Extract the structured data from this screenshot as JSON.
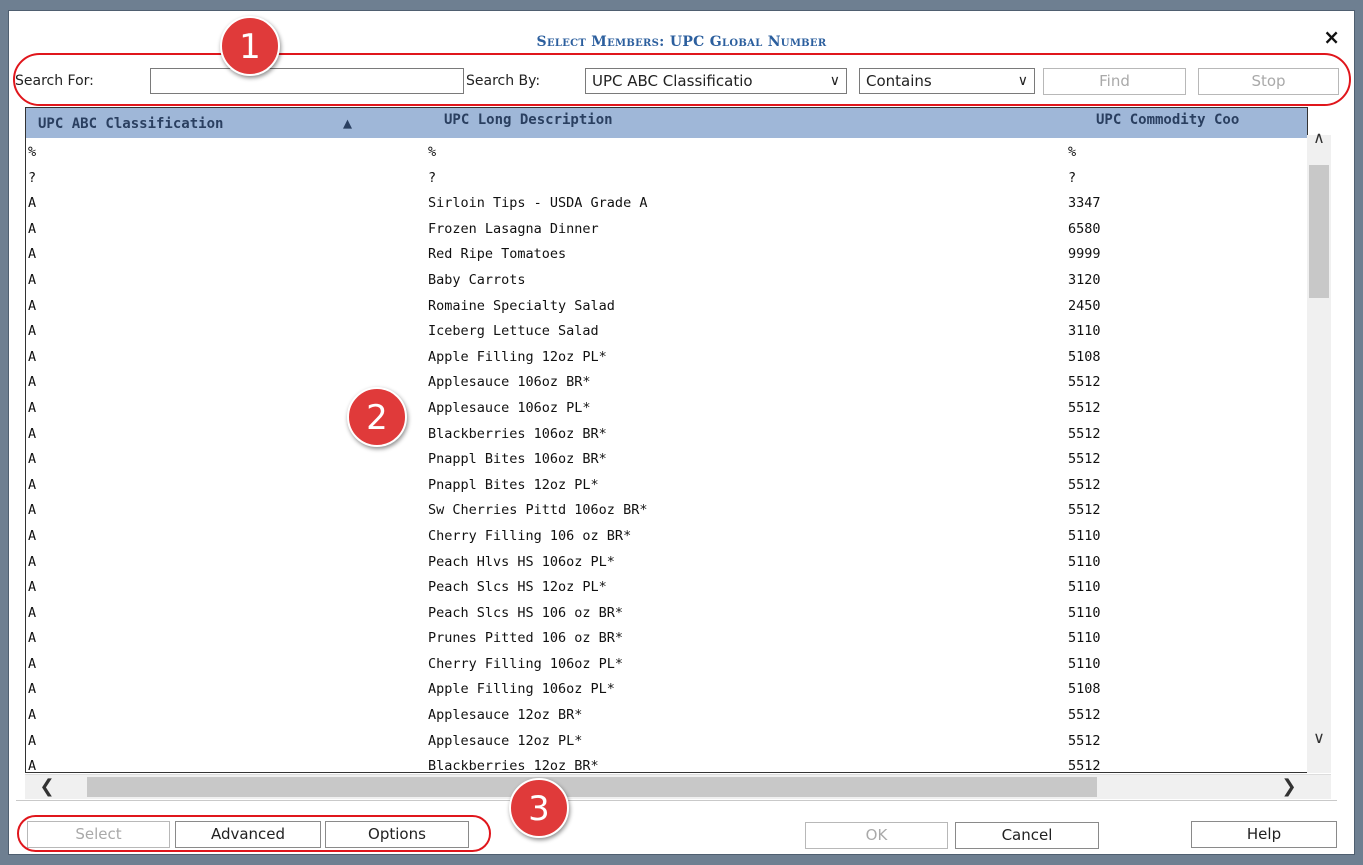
{
  "dialog": {
    "title": "Select Members: UPC Global Number",
    "close_glyph": "×"
  },
  "search": {
    "search_for_label": "Search For:",
    "search_for_value": "",
    "search_by_label": "Search By:",
    "search_by_value": "UPC ABC Classificatio",
    "match_mode_value": "Contains",
    "find_label": "Find",
    "stop_label": "Stop"
  },
  "grid": {
    "columns": [
      "UPC ABC Classification",
      "UPC Long Description",
      "UPC Commodity Coo"
    ],
    "sort_indicator": "▲",
    "rows": [
      [
        "%",
        "%",
        "%"
      ],
      [
        "?",
        "?",
        "?"
      ],
      [
        "A",
        "Sirloin Tips - USDA Grade A",
        "3347"
      ],
      [
        "A",
        "Frozen Lasagna Dinner",
        "6580"
      ],
      [
        "A",
        "Red Ripe Tomatoes",
        "9999"
      ],
      [
        "A",
        "Baby Carrots",
        "3120"
      ],
      [
        "A",
        "Romaine Specialty Salad",
        "2450"
      ],
      [
        "A",
        "Iceberg Lettuce Salad",
        "3110"
      ],
      [
        "A",
        "Apple Filling 12oz PL*",
        "5108"
      ],
      [
        "A",
        "Applesauce 106oz BR*",
        "5512"
      ],
      [
        "A",
        "Applesauce 106oz PL*",
        "5512"
      ],
      [
        "A",
        "Blackberries 106oz BR*",
        "5512"
      ],
      [
        "A",
        "Pnappl Bites 106oz BR*",
        "5512"
      ],
      [
        "A",
        "Pnappl Bites 12oz PL*",
        "5512"
      ],
      [
        "A",
        "Sw Cherries Pittd 106oz BR*",
        "5512"
      ],
      [
        "A",
        "Cherry Filling 106 oz BR*",
        "5110"
      ],
      [
        "A",
        "Peach Hlvs HS 106oz PL*",
        "5110"
      ],
      [
        "A",
        "Peach Slcs HS 12oz PL*",
        "5110"
      ],
      [
        "A",
        "Peach Slcs HS 106 oz BR*",
        "5110"
      ],
      [
        "A",
        "Prunes Pitted 106 oz BR*",
        "5110"
      ],
      [
        "A",
        "Cherry Filling 106oz PL*",
        "5110"
      ],
      [
        "A",
        "Apple Filling 106oz PL*",
        "5108"
      ],
      [
        "A",
        "Applesauce 12oz BR*",
        "5512"
      ],
      [
        "A",
        "Applesauce 12oz PL*",
        "5512"
      ],
      [
        "A",
        "Blackberries 12oz BR*",
        "5512"
      ]
    ]
  },
  "footer": {
    "select_label": "Select",
    "advanced_label": "Advanced",
    "options_label": "Options",
    "ok_label": "OK",
    "cancel_label": "Cancel",
    "help_label": "Help"
  },
  "callouts": [
    "1",
    "2",
    "3"
  ],
  "icons": {
    "up": "chevron-up-icon",
    "down": "chevron-down-icon",
    "left": "chevron-left-icon",
    "right": "chevron-right-icon"
  },
  "colors": {
    "header_bg": "#9fb7d8",
    "title": "#2c5f9e",
    "annotation_red": "#e0161c"
  }
}
